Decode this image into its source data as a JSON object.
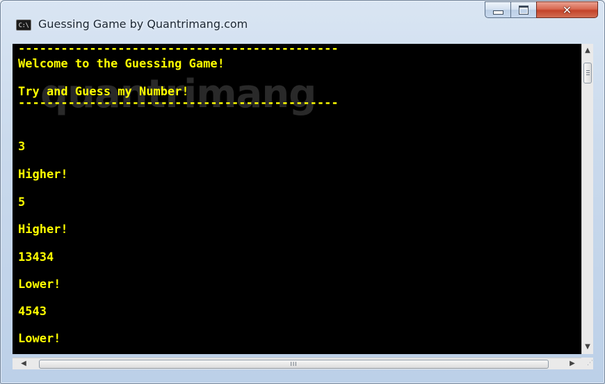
{
  "window": {
    "title": "Guessing Game by Quantrimang.com",
    "icon_label": "C:\\",
    "buttons": {
      "minimize": "minimize",
      "maximize": "maximize",
      "close": "✕"
    }
  },
  "console": {
    "text_color": "#ffff00",
    "background": "#000000",
    "watermark": "quantrimang",
    "lines": [
      "---------------------------------------------",
      "Welcome to the Guessing Game!",
      "Try and Guess my Number!",
      "---------------------------------------------",
      "",
      "3",
      "Higher!",
      "5",
      "Higher!",
      "13434",
      "Lower!",
      "4543",
      "Lower!"
    ]
  },
  "scrollbars": {
    "h_thumb_glyph": "III",
    "up_arrow": "▲",
    "down_arrow": "▼",
    "left_arrow": "◀",
    "right_arrow": "▶"
  }
}
